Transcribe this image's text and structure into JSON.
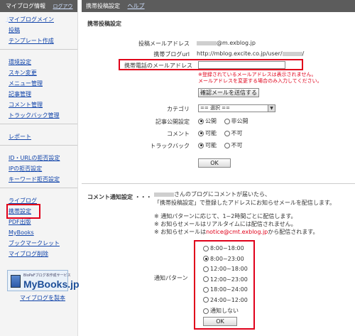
{
  "sidebar": {
    "header": "マイブログ情報",
    "logout": "ログアウト",
    "groups": [
      [
        "マイブログメイン",
        "投稿",
        "テンプレート作成"
      ],
      [
        "環境設定",
        "スキン変更",
        "メニュー管理",
        "記事管理",
        "コメント管理",
        "トラックバック管理"
      ],
      [
        "レポート"
      ],
      [
        "ID・URLの拒否設定",
        "IPの拒否設定",
        "キーワード拒否設定"
      ],
      [
        "ライブログ",
        "携帯設定",
        "PDF出版",
        "MyBooks",
        "ブックマークレット",
        "マイブログ削除"
      ]
    ],
    "banner_small": "BloPaFブログ本作成サービス",
    "banner_big": "MyBooks.jp",
    "banner_link": "マイブログを製本"
  },
  "header": {
    "title": "携帯投稿設定",
    "help": "ヘルプ"
  },
  "form": {
    "section_title": "携帯投稿設定",
    "post_email_label": "投稿メールアドレス",
    "post_email_value": "@m.exblog.jp",
    "mobile_url_label": "携帯ブログurl",
    "mobile_url_value": "http://mblog.excite.co.jp/user/",
    "mobile_email_label": "携帯電話のメールアドレス",
    "mobile_email_value": "",
    "note1": "※登録されているメールアドレスは表示されません。",
    "note2": "メールアドレスを変更する場合のみ入力してください。",
    "confirm_button": "確認メールを送信する",
    "category_label": "カテゴリ",
    "category_value": "== 選択 ==",
    "publish_label": "記事公開設定",
    "publish_options": [
      "公開",
      "非公開"
    ],
    "comment_label": "コメント",
    "comment_options": [
      "可能",
      "不可"
    ],
    "trackback_label": "トラックバック",
    "trackback_options": [
      "可能",
      "不可"
    ],
    "ok": "OK"
  },
  "notify": {
    "label": "コメント通知設定 ・・・",
    "line1_suffix": "さんのブログにコメントが届いたら、",
    "line2": "「携帯投稿設定」で登録したアドレスにお知らせメールを配信します。",
    "note1": "※ 通知パターンに応じて、1~2時間ごとに配信します。",
    "note2": "※ お知らせメールはリアルタイムには配信されません。",
    "note3_a": "※ お知らせメールは",
    "note3_b": "notice@cmt.exblog.jp",
    "note3_c": "から配信されます。",
    "pattern_label": "通知パターン",
    "options": [
      "8:00~18:00",
      "8:00~23:00",
      "12:00~18:00",
      "12:00~23:00",
      "18:00~24:00",
      "24:00~12:00",
      "通知しない"
    ],
    "selected": 1,
    "ok": "OK"
  }
}
